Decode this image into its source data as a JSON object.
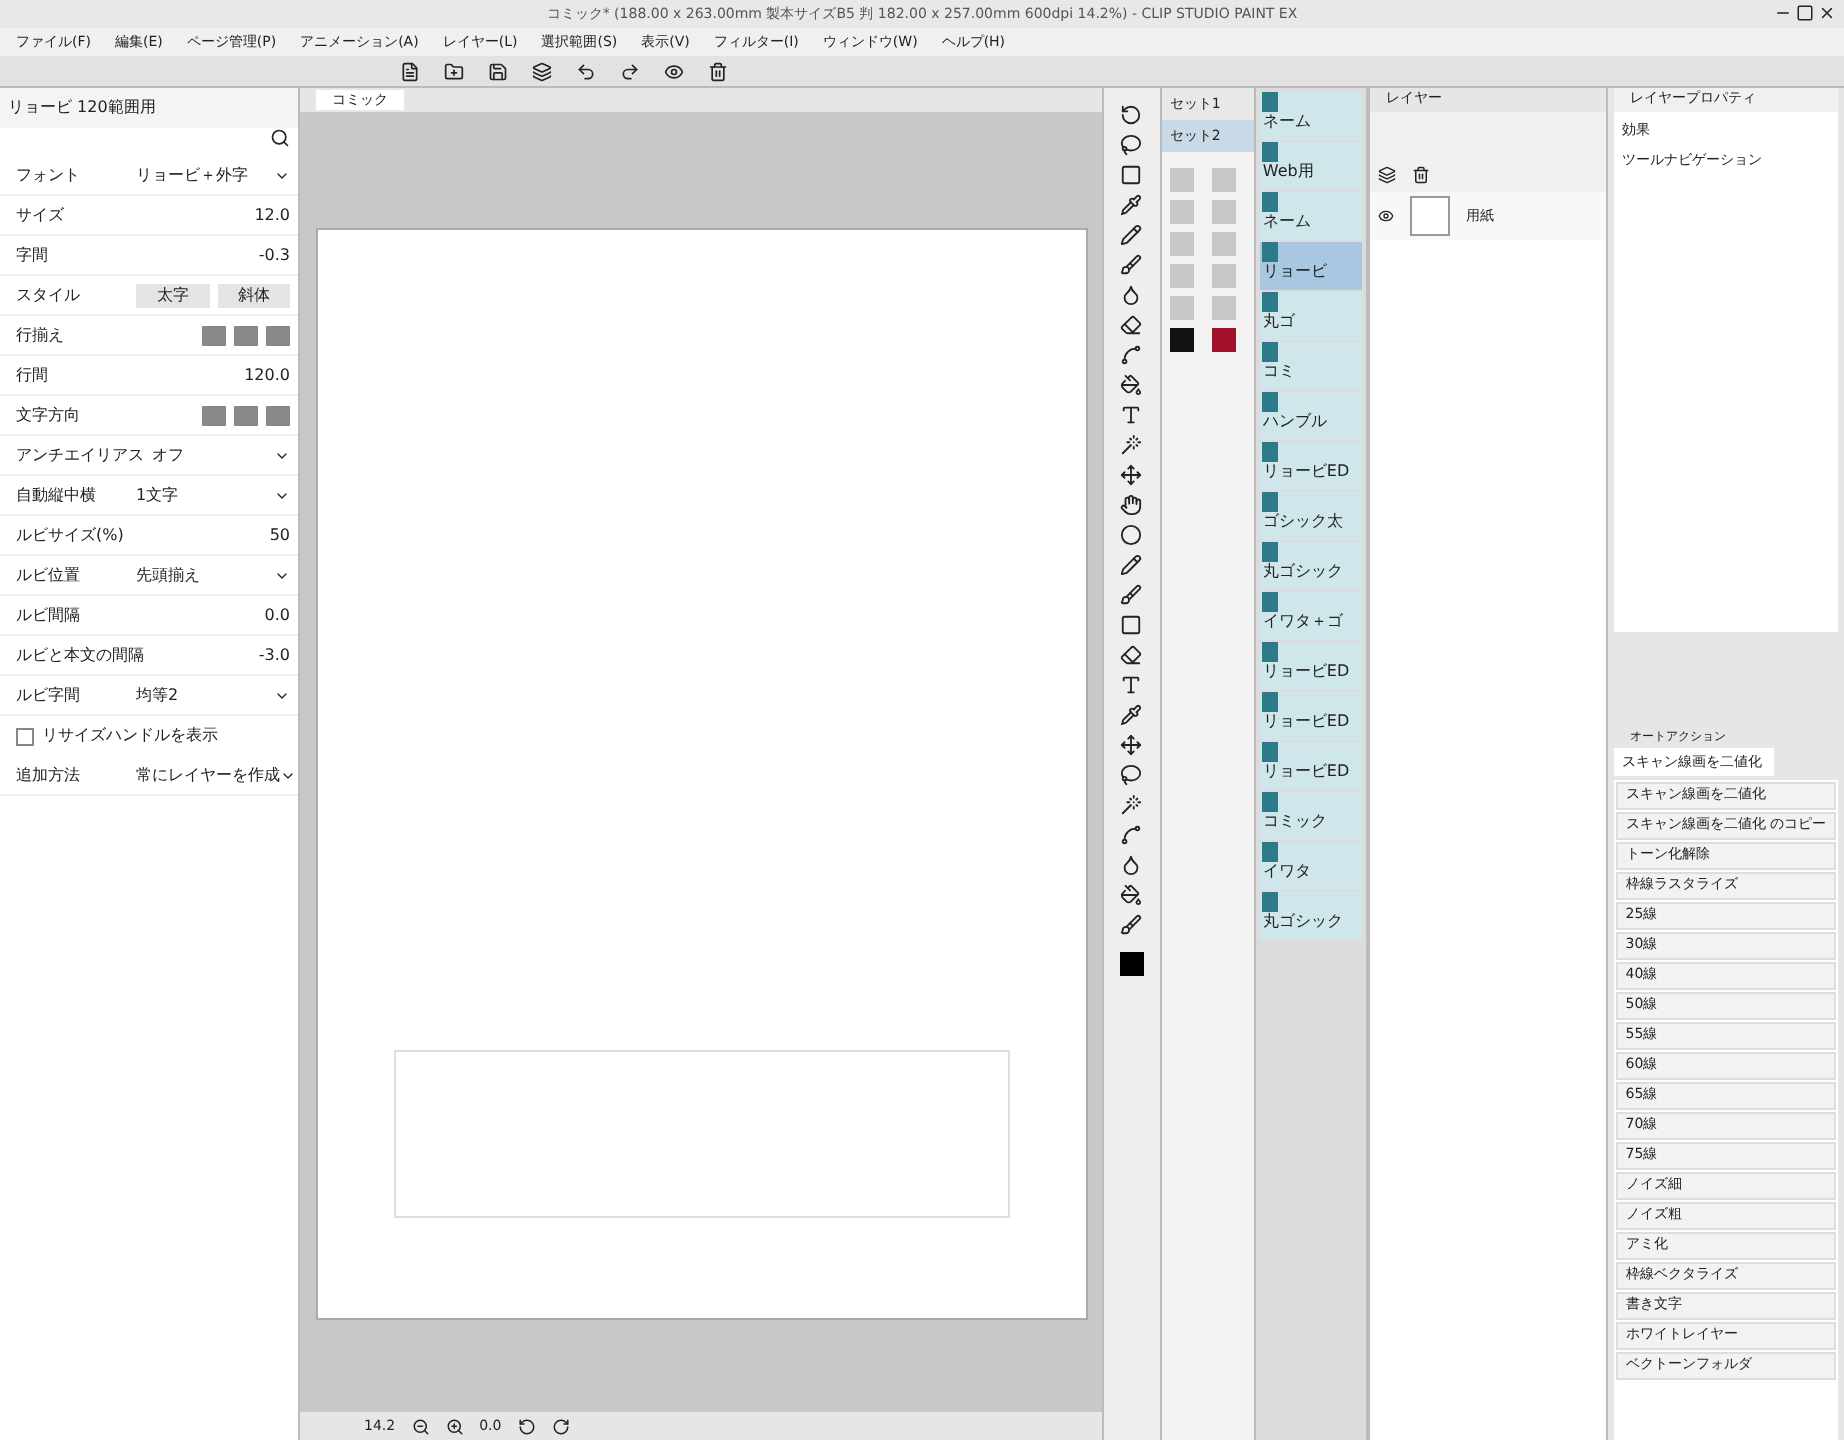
{
  "window": {
    "title": "コミック* (188.00 x 263.00mm 製本サイズB5 判 182.00 x 257.00mm 600dpi 14.2%) - CLIP STUDIO PAINT EX"
  },
  "menu": [
    "ファイル(F)",
    "編集(E)",
    "ページ管理(P)",
    "アニメーション(A)",
    "レイヤー(L)",
    "選択範囲(S)",
    "表示(V)",
    "フィルター(I)",
    "ウィンドウ(W)",
    "ヘルプ(H)"
  ],
  "tool_property": {
    "subtool": "リョービ 120範囲用",
    "rows": [
      {
        "kind": "dropdown",
        "label": "フォント",
        "value": "リョービ＋外字"
      },
      {
        "kind": "number",
        "label": "サイズ",
        "value": "12.0"
      },
      {
        "kind": "number",
        "label": "字間",
        "value": "-0.3"
      },
      {
        "kind": "style",
        "label": "スタイル",
        "options": [
          "太字",
          "斜体"
        ]
      },
      {
        "kind": "icons",
        "label": "行揃え"
      },
      {
        "kind": "number",
        "label": "行間",
        "value": "120.0"
      },
      {
        "kind": "icons",
        "label": "文字方向"
      },
      {
        "kind": "dropdown",
        "label": "アンチエイリアス",
        "value": "オフ"
      },
      {
        "kind": "dropdown",
        "label": "自動縦中横",
        "value": "1文字"
      },
      {
        "kind": "number",
        "label": "ルビサイズ(%)",
        "value": "50"
      },
      {
        "kind": "dropdown",
        "label": "ルビ位置",
        "value": "先頭揃え"
      },
      {
        "kind": "number",
        "label": "ルビ間隔",
        "value": "0.0"
      },
      {
        "kind": "number",
        "label": "ルビと本文の間隔",
        "value": "-3.0"
      },
      {
        "kind": "dropdown",
        "label": "ルビ字間",
        "value": "均等2"
      },
      {
        "kind": "checkbox",
        "label": "リサイズハンドルを表示",
        "checked": false
      },
      {
        "kind": "dropdown",
        "label": "追加方法",
        "value": "常にレイヤーを作成"
      }
    ]
  },
  "canvas": {
    "tab": "コミック",
    "zoom": "14.2",
    "angle": "0.0"
  },
  "subtool_sets": [
    {
      "label": "セット1",
      "selected": false
    },
    {
      "label": "セット2",
      "selected": true
    }
  ],
  "subtools": [
    {
      "label": "ネーム",
      "selected": false
    },
    {
      "label": "Web用",
      "selected": false
    },
    {
      "label": "ネーム",
      "selected": false
    },
    {
      "label": "リョービ",
      "selected": true
    },
    {
      "label": "丸ゴ",
      "selected": false
    },
    {
      "label": "コミ",
      "selected": false
    },
    {
      "label": "ハンブル",
      "selected": false
    },
    {
      "label": "リョービED",
      "selected": false
    },
    {
      "label": "ゴシック太",
      "selected": false
    },
    {
      "label": "丸ゴシック",
      "selected": false
    },
    {
      "label": "イワタ＋ゴ",
      "selected": false
    },
    {
      "label": "リョービED",
      "selected": false
    },
    {
      "label": "リョービED",
      "selected": false
    },
    {
      "label": "リョービED",
      "selected": false
    },
    {
      "label": "コミック",
      "selected": false
    },
    {
      "label": "イワタ",
      "selected": false
    },
    {
      "label": "丸ゴシック",
      "selected": false
    }
  ],
  "layer_panel": {
    "tab": "レイヤー",
    "layers": [
      {
        "name": "用紙"
      }
    ]
  },
  "layer_property": {
    "tab": "レイヤープロパティ",
    "effect": "効果",
    "tool_nav": "ツールナビゲーション"
  },
  "auto_action": {
    "tab": "オートアクション",
    "set": "スキャン線画を二値化",
    "items": [
      "スキャン線画を二値化",
      "スキャン線画を二値化 のコピー",
      "トーン化解除",
      "枠線ラスタライズ",
      "25線",
      "30線",
      "40線",
      "50線",
      "55線",
      "60線",
      "65線",
      "70線",
      "75線",
      "ノイズ細",
      "ノイズ粗",
      "アミ化",
      "枠線ベクタライズ",
      "書き文字",
      "ホワイトレイヤー",
      "ベクトーンフォルダ"
    ]
  }
}
